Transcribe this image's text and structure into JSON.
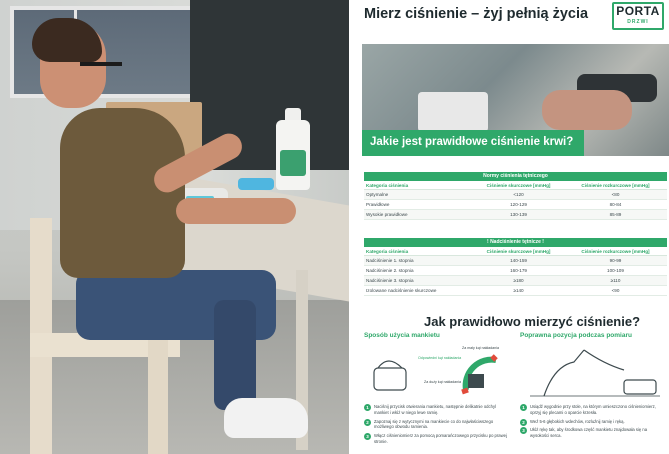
{
  "poster": {
    "title": "Mierz ciśnienie – żyj pełnią życia",
    "logo_word": "PORTA",
    "logo_sub": "DRZWI",
    "banner": "Jakie jest prawidłowe ciśnienie krwi?",
    "colors": {
      "accent": "#2fa86a",
      "text": "#1e2a2e"
    }
  },
  "table_normal": {
    "heading": "Normy ciśnienia tętniczego",
    "columns": [
      "Kategoria ciśnienia",
      "Ciśnienie skurczowe [mmHg]",
      "Ciśnienie rozkurczowe [mmHg]"
    ],
    "rows": [
      [
        "Optymalne",
        "<120",
        "<80"
      ],
      [
        "Prawidłowe",
        "120-129",
        "80-84"
      ],
      [
        "Wysokie prawidłowe",
        "130-139",
        "85-89"
      ]
    ]
  },
  "table_high": {
    "heading": "!   Nadciśnienie tętnicze   !",
    "columns": [
      "Kategoria ciśnienia",
      "Ciśnienie skurczowe [mmHg]",
      "Ciśnienie rozkurczowe [mmHg]"
    ],
    "rows": [
      [
        "Nadciśnienie 1. stopnia",
        "140-159",
        "90-99"
      ],
      [
        "Nadciśnienie 2. stopnia",
        "160-179",
        "100-109"
      ],
      [
        "Nadciśnienie 3. stopnia",
        "≥180",
        "≥110"
      ],
      [
        "Izolowane nadciśnienie skurczowe",
        "≥140",
        "<90"
      ]
    ]
  },
  "measure": {
    "heading": "Jak prawidłowo mierzyć ciśnienie?",
    "left_title": "Sposób użycia mankietu",
    "right_title": "Poprawna pozycja podczas pomiaru",
    "annotations": [
      "Za mały kąt nakładania",
      "Odpowiedni kąt nakładania",
      "Za duży kąt nakładania"
    ],
    "left_steps": [
      {
        "n": "1",
        "text": "Naciśnij przycisk otwierania mankietu, następnie delikatnie odchyl mankiet i włóż w niego lewe ramię."
      },
      {
        "n": "2",
        "text": "Zapoznaj się z wytycznymi na mankiecie co do najwłaściwszego możliwego obwodu ramienia."
      },
      {
        "n": "3",
        "text": "Włącz ciśnieniomierz za pomocą pomarańczowego przycisku po prawej stronie."
      }
    ],
    "right_steps": [
      {
        "n": "1",
        "text": "Usiądź wygodnie przy stole, na którym umieszczono ciśnieniomierz, oprzyj się plecami o oparcie krzesła."
      },
      {
        "n": "2",
        "text": "Weź 5-6 głębokich wdechów, rozluźnij ramię i ręką."
      },
      {
        "n": "3",
        "text": "Ułóż rękę tak, aby środkowa część mankietu znajdowała się na wysokości serca."
      }
    ]
  }
}
